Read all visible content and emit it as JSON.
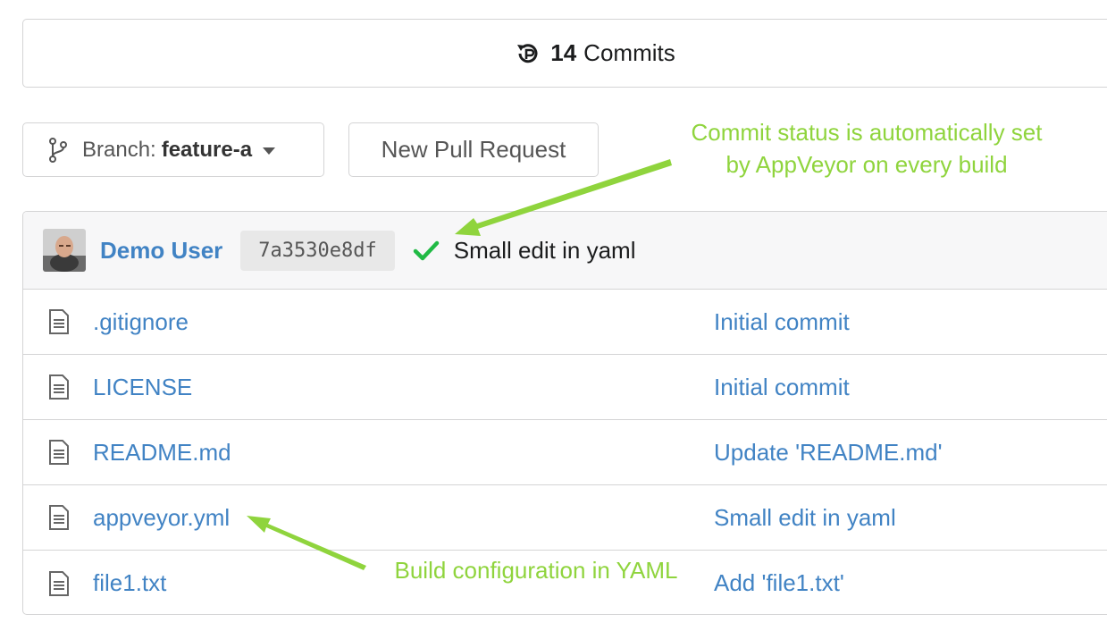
{
  "commits": {
    "count": "14",
    "label": "Commits",
    "icon": "history-icon"
  },
  "branch": {
    "prefix": "Branch:",
    "name": "feature-a",
    "icon": "git-branch-icon"
  },
  "new_pr_label": "New Pull Request",
  "latest_commit": {
    "author": "Demo User",
    "sha": "7a3530e8df",
    "message": "Small edit in yaml",
    "status": "success",
    "status_color": "#21ba45"
  },
  "files": [
    {
      "name": ".gitignore",
      "commit": "Initial commit"
    },
    {
      "name": "LICENSE",
      "commit": "Initial commit"
    },
    {
      "name": "README.md",
      "commit": "Update 'README.md'"
    },
    {
      "name": "appveyor.yml",
      "commit": "Small edit in yaml"
    },
    {
      "name": "file1.txt",
      "commit": "Add 'file1.txt'"
    }
  ],
  "annotations": {
    "top_line1": "Commit status is automatically set",
    "top_line2": "by AppVeyor on every build",
    "bottom": "Build configuration in YAML",
    "color": "#8fd43d"
  },
  "colors": {
    "link": "#4183c4",
    "border": "#d4d4d5"
  }
}
